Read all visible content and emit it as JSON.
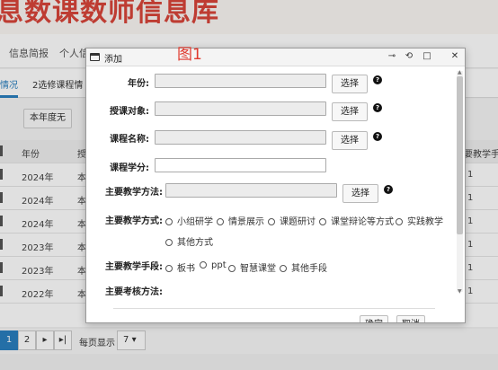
{
  "background": {
    "banner_title": "息数课数师信息库",
    "nav": [
      "信息简报",
      "个人信"
    ],
    "tabs": [
      "情况",
      "2选修课程情"
    ],
    "toolbar_button": "本年度无",
    "table": {
      "headers": [
        "年份",
        "授",
        "要教学手"
      ],
      "rows": [
        {
          "year": "2024年",
          "c2": "本",
          "c3": "1"
        },
        {
          "year": "2024年",
          "c2": "本",
          "c3": "1"
        },
        {
          "year": "2024年",
          "c2": "本",
          "c3": "1"
        },
        {
          "year": "2023年",
          "c2": "本",
          "c3": "1"
        },
        {
          "year": "2023年",
          "c2": "本",
          "c3": "1"
        },
        {
          "year": "2022年",
          "c2": "本",
          "c3": "1"
        }
      ]
    },
    "pager": {
      "pages": [
        "1",
        "2"
      ],
      "next": "▸",
      "last": "▸|",
      "per_page_label": "每页显示",
      "per_page_value": "7"
    }
  },
  "figure_label": "图1",
  "dialog": {
    "title": "添加",
    "controls": {
      "pin": "⊸",
      "restore": "⟲",
      "maximize": "□",
      "close": "✕"
    },
    "fields": {
      "year_label": "年份:",
      "target_label": "授课对象:",
      "course_name_label": "课程名称:",
      "credit_label": "课程学分:",
      "teaching_method_select_label": "主要教学方法:",
      "teaching_method_label": "主要教学方式:",
      "teaching_means_label": "主要教学手段:",
      "assessment_label": "主要考核方法:"
    },
    "select_button": "选择",
    "help_glyph": "?",
    "teaching_method_options": [
      "小组研学",
      "情景展示",
      "课题研讨",
      "课堂辩论等方式",
      "实践教学",
      "其他方式"
    ],
    "teaching_means_options": [
      "板书",
      "ppt",
      "智慧课堂",
      "其他手段"
    ],
    "confirm_button": "确定",
    "cancel_button": "取消"
  }
}
